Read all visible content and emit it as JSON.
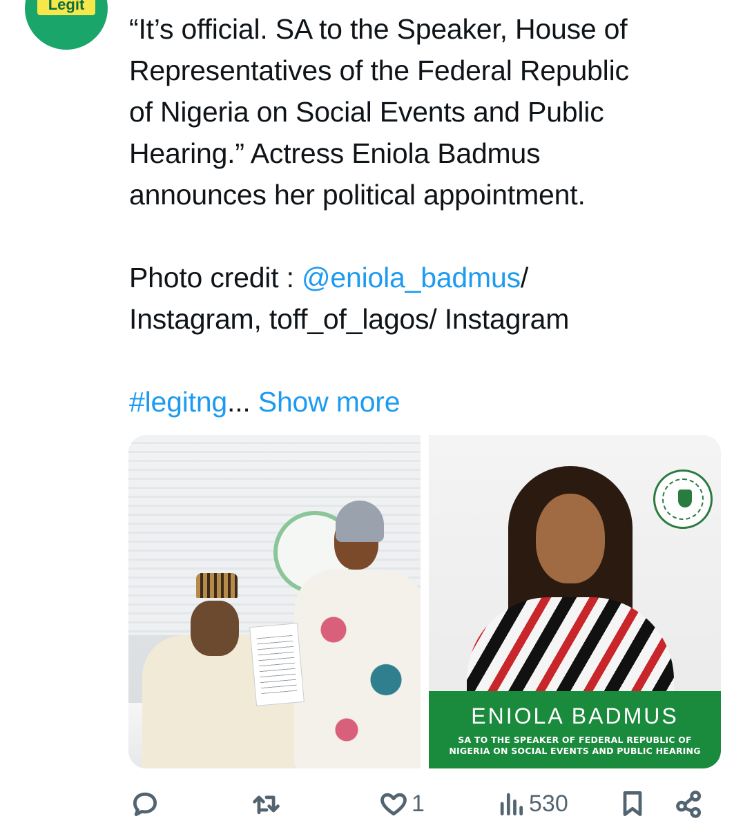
{
  "avatar": {
    "badge": "Legit"
  },
  "tweet": {
    "lines": [
      "“It’s official. SA to the Speaker, House of",
      "Representatives of the Federal Republic",
      "of Nigeria on Social Events and Public",
      "Hearing.” Actress Eniola Badmus",
      "announces her political appointment."
    ],
    "credit_prefix": "Photo credit : ",
    "credit_mention": "@eniola_badmus",
    "credit_after_mention": "/",
    "credit_line2": "Instagram, toff_of_lagos/ Instagram",
    "hashtag": "#legitng",
    "ellipsis": "... ",
    "show_more": "Show more"
  },
  "media": {
    "right_banner_name": "ENIOLA BADMUS",
    "right_banner_sub_1": "SA TO THE SPEAKER OF FEDERAL REPUBLIC OF",
    "right_banner_sub_2": "NIGERIA ON SOCIAL EVENTS AND PUBLIC HEARING"
  },
  "actions": {
    "reply_count": "",
    "retweet_count": "",
    "like_count": "1",
    "views_count": "530"
  },
  "colors": {
    "link": "#1d9bf0",
    "text": "#0f1419",
    "muted": "#536471",
    "banner_green": "#1a8a3c",
    "avatar_green": "#1aa66a",
    "avatar_badge": "#f6e84a"
  }
}
